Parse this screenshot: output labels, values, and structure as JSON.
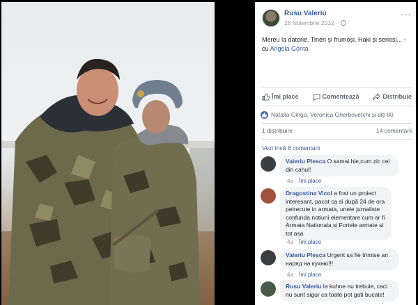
{
  "post": {
    "author": "Rusu Valeriu",
    "date": "28 Noiembrie 2012",
    "more": "···",
    "text": "Mereu la datorie. Tineri și frumoși. Haki și serioși... -",
    "with_prefix": "cu",
    "with_name": "Angela Gonta"
  },
  "actions": {
    "like": "Îmi place",
    "comment": "Comentează",
    "share": "Distribuie"
  },
  "reactions": {
    "text": "Natalia Ginga, Veronica Gherbovețchi și alți 80"
  },
  "stats": {
    "shares": "1 distribuire",
    "comments": "14 comentarii"
  },
  "view_more": "Vezi încă 8 comentarii",
  "comments": [
    {
      "name": "Valeriu Plesca",
      "text": "O samai hie,cum zic cei din cahul!",
      "time": "4a",
      "reply": "Îmi place",
      "avatar_color": "#3a3f44"
    },
    {
      "name": "Dragostina Vicol",
      "text": "a fost un proiect interesant, pacat ca si după 24 de ora petrecute in armata, unele jurnaliste confunda notiuni elementare cum ar fi Armata Nationala si Fortele armate si tot asa",
      "time": "4a",
      "reply": "Îmi place",
      "avatar_color": "#a0523f"
    },
    {
      "name": "Valeriu Plesca",
      "text": "Urgent sa fie trimise an наряд на кухню!!!",
      "time": "4a",
      "reply": "Îmi place",
      "avatar_color": "#3a3f44"
    },
    {
      "name": "Rusu Valeriu",
      "text": "la kuhne nu trebuie, caci nu sunt sigur ca toate pot gati bucate!",
      "time": "",
      "reply": "",
      "avatar_color": "#4a5a48"
    }
  ]
}
